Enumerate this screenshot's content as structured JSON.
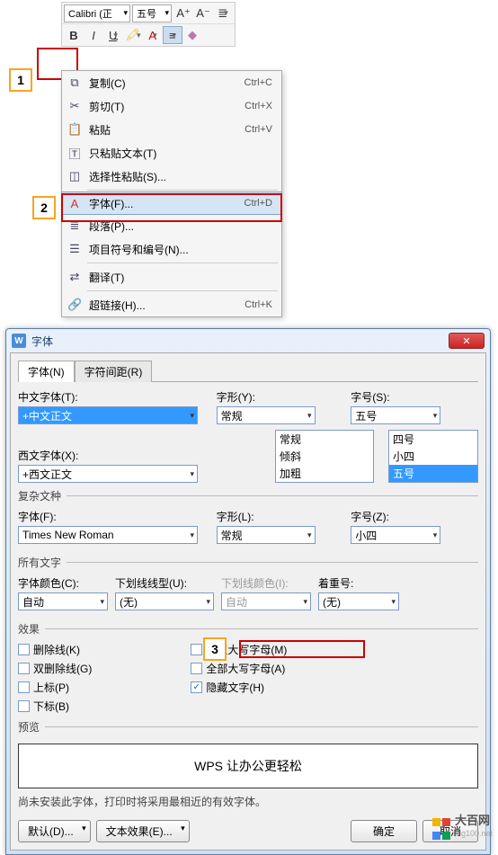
{
  "toolbar": {
    "font_name": "Calibri (正",
    "font_size": "五号"
  },
  "callouts": {
    "c1": "1",
    "c2": "2",
    "c3": "3"
  },
  "context_menu": [
    {
      "icon": "⧉",
      "label": "复制(C)",
      "shortcut": "Ctrl+C"
    },
    {
      "icon": "✂",
      "label": "剪切(T)",
      "shortcut": "Ctrl+X"
    },
    {
      "icon": "📋",
      "label": "粘贴",
      "shortcut": "Ctrl+V"
    },
    {
      "icon": "🅃",
      "label": "只粘贴文本(T)",
      "shortcut": ""
    },
    {
      "icon": "◫",
      "label": "选择性粘贴(S)...",
      "shortcut": ""
    },
    {
      "sep": true
    },
    {
      "icon": "A",
      "label": "字体(F)...",
      "shortcut": "Ctrl+D",
      "sel": true
    },
    {
      "icon": "≣",
      "label": "段落(P)...",
      "shortcut": ""
    },
    {
      "icon": "☰",
      "label": "项目符号和编号(N)...",
      "shortcut": ""
    },
    {
      "sep": true
    },
    {
      "icon": "⇄",
      "label": "翻译(T)",
      "shortcut": ""
    },
    {
      "sep": true
    },
    {
      "icon": "🔗",
      "label": "超链接(H)...",
      "shortcut": "Ctrl+K"
    }
  ],
  "dialog": {
    "title": "字体",
    "tabs": {
      "t1": "字体(N)",
      "t2": "字符间距(R)"
    },
    "labels": {
      "cn_font": "中文字体(T):",
      "en_font": "西文字体(X):",
      "style": "字形(Y):",
      "size": "字号(S):",
      "complex": "复杂文种",
      "cfont": "字体(F):",
      "cstyle": "字形(L):",
      "csize": "字号(Z):",
      "alltext": "所有文字",
      "fontcolor": "字体颜色(C):",
      "underline": "下划线线型(U):",
      "ulcolor": "下划线颜色(I):",
      "emphasis": "着重号:",
      "effects": "效果",
      "preview": "预览"
    },
    "values": {
      "cn_font": "+中文正文",
      "en_font": "+西文正文",
      "style": "常规",
      "size": "五号",
      "style_list": [
        "常规",
        "倾斜",
        "加粗"
      ],
      "size_list": [
        "四号",
        "小四",
        "五号"
      ],
      "cfont": "Times New Roman",
      "cstyle": "常规",
      "csize": "小四",
      "auto": "自动",
      "none": "(无)"
    },
    "checkboxes": {
      "strike": "删除线(K)",
      "dstrike": "双删除线(G)",
      "sup": "上标(P)",
      "sub": "下标(B)",
      "smallcaps": "小型大写字母(M)",
      "allcaps": "全部大写字母(A)",
      "hidden": "隐藏文字(H)"
    },
    "preview_text": "WPS 让办公更轻松",
    "note": "尚未安装此字体，打印时将采用最相近的有效字体。",
    "buttons": {
      "default": "默认(D)...",
      "texteffect": "文本效果(E)...",
      "ok": "确定",
      "cancel": "取消"
    }
  },
  "watermark": {
    "brand": "大百网",
    "url": "big100.net"
  }
}
